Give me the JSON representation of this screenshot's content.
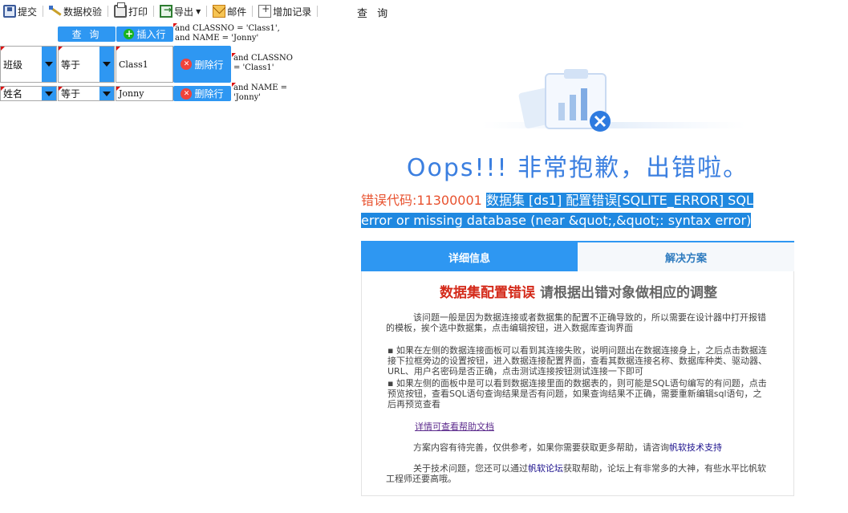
{
  "toolbar": {
    "submit": "提交",
    "validate": "数据校验",
    "print": "打印",
    "export": "导出",
    "mail": "邮件",
    "add_record": "增加记录",
    "query_title": "查 询"
  },
  "query": {
    "query_button": "查 询",
    "insert_button": "插入行",
    "delete_button": "删除行",
    "sql_lines": [
      "and CLASSNO = 'Class1',\nand NAME = 'Jonny'",
      "and CLASSNO\n= 'Class1'",
      "and NAME =\n'Jonny'"
    ],
    "rows": [
      {
        "field": "班级",
        "operator": "等于",
        "value": "Class1"
      },
      {
        "field": "姓名",
        "operator": "等于",
        "value": "Jonny"
      }
    ]
  },
  "error": {
    "title": "Oops!!! 非常抱歉，出错啦。",
    "code_label": "错误代码:11300001",
    "message": "数据集 [ds1] 配置错误[SQLITE_ERROR] SQL error or missing database (near &quot;,&quot;: syntax error)",
    "tabs": [
      "详细信息",
      "解决方案"
    ],
    "panel_title_red": "数据集配置错误",
    "panel_title_gray": "请根据出错对象做相应的调整",
    "para1": "该问题一般是因为数据连接或者数据集的配置不正确导致的，所以需要在设计器中打开报错的模板，挨个选中数据集，点击编辑按钮，进入数据库查询界面",
    "bullet1": "如果在左侧的数据连接面板可以看到其连接失败，说明问题出在数据连接身上，之后点击数据连接下拉框旁边的设置按钮，进入数据连接配置界面，查看其数据连接名称、数据库种类、驱动器、URL、用户名密码是否正确，点击测试连接按钮测试连接一下即可",
    "bullet2": "如果左侧的面板中是可以看到数据连接里面的数据表的，则可能是SQL语句编写的有问题，点击预览按钮，查看SQL语句查询结果是否有问题，如果查询结果不正确，需要重新编辑sql语句，之后再预览查看",
    "help_link": "详情可查看帮助文档",
    "para2_prefix": "方案内容有待完善，仅供参考，如果你需要获取更多帮助，请咨询",
    "para2_link": "帆软技术支持",
    "para3_prefix": "关于技术问题，您还可以通过",
    "para3_link": "帆软论坛",
    "para3_suffix": "获取帮助，论坛上有非常多的大神，有些水平比帆软工程师还要高哦。"
  },
  "colors": {
    "accent": "#2e97f2",
    "error_title": "#3b7fe0",
    "error_code": "#e8522f"
  }
}
